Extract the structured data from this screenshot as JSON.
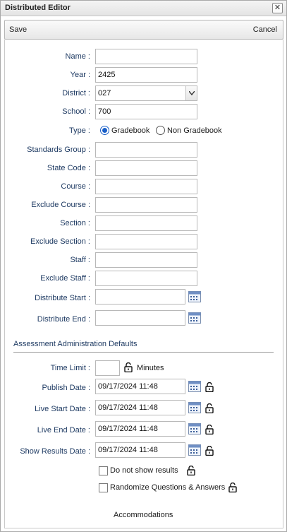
{
  "window": {
    "title": "Distributed Editor",
    "close_glyph": "✕"
  },
  "toolbar": {
    "save_label": "Save",
    "cancel_label": "Cancel"
  },
  "form": {
    "name": {
      "label": "Name :",
      "value": ""
    },
    "year": {
      "label": "Year :",
      "value": "2425"
    },
    "district": {
      "label": "District :",
      "value": "027"
    },
    "school": {
      "label": "School :",
      "value": "700"
    },
    "type": {
      "label": "Type :",
      "options": [
        {
          "label": "Gradebook",
          "selected": true
        },
        {
          "label": "Non Gradebook",
          "selected": false
        }
      ]
    },
    "standards_group": {
      "label": "Standards Group :",
      "value": ""
    },
    "state_code": {
      "label": "State Code :",
      "value": ""
    },
    "course": {
      "label": "Course :",
      "value": ""
    },
    "exclude_course": {
      "label": "Exclude Course :",
      "value": ""
    },
    "section": {
      "label": "Section :",
      "value": ""
    },
    "exclude_section": {
      "label": "Exclude Section :",
      "value": ""
    },
    "staff": {
      "label": "Staff :",
      "value": ""
    },
    "exclude_staff": {
      "label": "Exclude Staff :",
      "value": ""
    },
    "distribute_start": {
      "label": "Distribute Start :",
      "value": ""
    },
    "distribute_end": {
      "label": "Distribute End :",
      "value": ""
    }
  },
  "defaults": {
    "section_title": "Assessment Administration Defaults",
    "time_limit": {
      "label": "Time Limit :",
      "value": "",
      "unit": "Minutes"
    },
    "publish_date": {
      "label": "Publish Date :",
      "value": "09/17/2024 11:48"
    },
    "live_start_date": {
      "label": "Live Start Date :",
      "value": "09/17/2024 11:48"
    },
    "live_end_date": {
      "label": "Live End Date :",
      "value": "09/17/2024 11:48"
    },
    "show_results_date": {
      "label": "Show Results Date :",
      "value": "09/17/2024 11:48"
    },
    "do_not_show_results": {
      "label": "Do not show results",
      "checked": false
    },
    "randomize": {
      "label": "Randomize Questions & Answers",
      "checked": false
    }
  },
  "accommodations": {
    "title": "Accommodations"
  },
  "icons": {
    "calendar": "calendar-icon",
    "lock": "lock-open-icon",
    "close": "close-icon",
    "dropdown": "chevron-down-icon"
  }
}
